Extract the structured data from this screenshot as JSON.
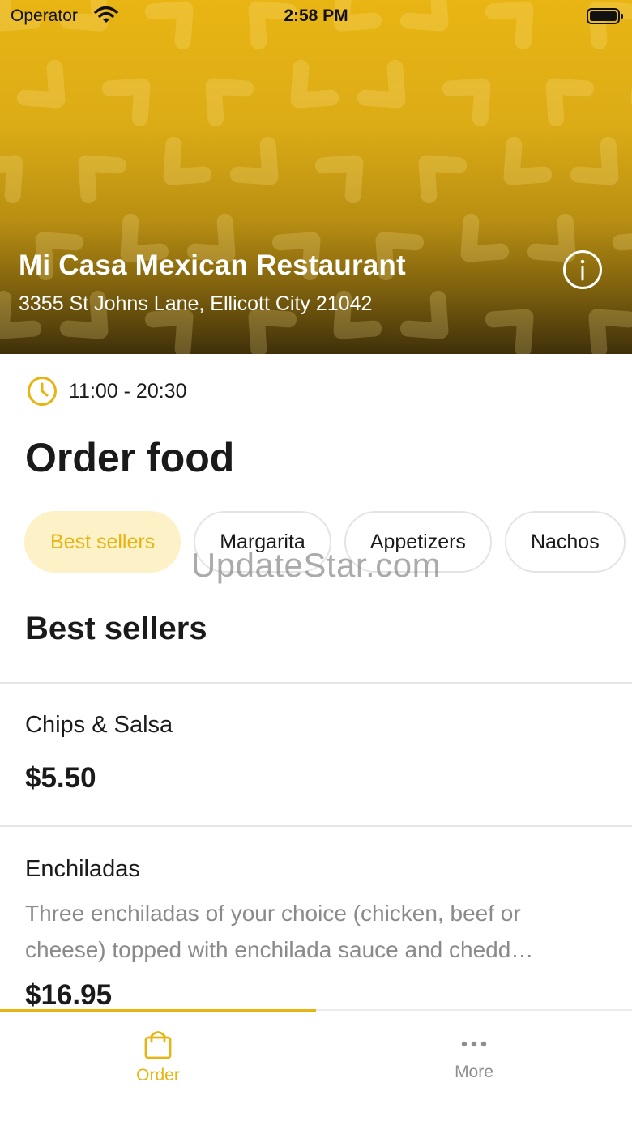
{
  "status_bar": {
    "carrier": "Operator",
    "time": "2:58 PM"
  },
  "restaurant": {
    "name": "Mi Casa Mexican Restaurant",
    "address": "3355 St Johns Lane, Ellicott City 21042",
    "hours": "11:00 - 20:30"
  },
  "page": {
    "title": "Order food"
  },
  "categories": [
    {
      "label": "Best sellers",
      "active": true
    },
    {
      "label": "Margarita",
      "active": false
    },
    {
      "label": "Appetizers",
      "active": false
    },
    {
      "label": "Nachos",
      "active": false
    }
  ],
  "watermark": "UpdateStar.com",
  "section": {
    "title": "Best sellers"
  },
  "items": [
    {
      "name": "Chips & Salsa",
      "description": "",
      "price": "$5.50"
    },
    {
      "name": "Enchiladas",
      "description": "Three enchiladas of your choice (chicken, beef or cheese) topped with enchilada sauce and chedd…",
      "price": "$16.95"
    }
  ],
  "tabbar": {
    "order_label": "Order",
    "more_label": "More"
  },
  "colors": {
    "accent": "#e7b410",
    "accent_light": "#fdf1c8",
    "hero_top": "#e9b514",
    "hero_bottom": "#3f300a"
  },
  "icons": {
    "info": "info-icon",
    "clock": "clock-icon",
    "order": "shopping-bag-icon",
    "more": "more-dots-icon",
    "wifi": "wifi-icon",
    "battery": "battery-icon"
  }
}
